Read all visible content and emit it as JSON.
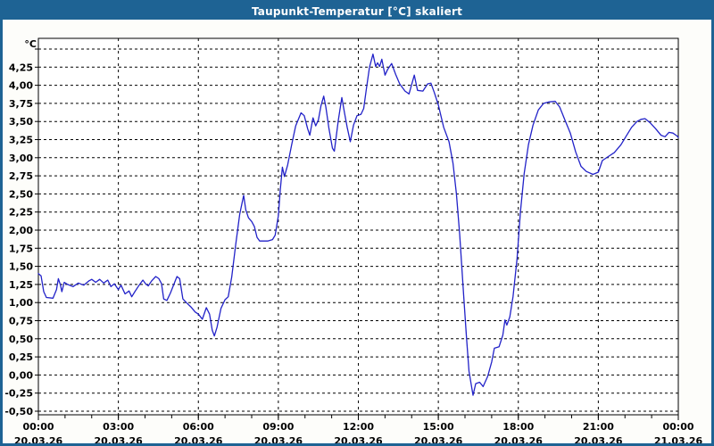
{
  "window": {
    "title": "Taupunkt-Temperatur [°C] skaliert",
    "titlebar_color": "#1e6394",
    "border_color": "#1e6394",
    "background_color": "#fdfdfa"
  },
  "chart_data": {
    "type": "line",
    "title": "Taupunkt-Temperatur [°C] skaliert",
    "y_unit_label": "°C",
    "xlabel": "",
    "ylabel": "°C",
    "ylim": [
      -0.5,
      4.5
    ],
    "xlim_hours": [
      0,
      24
    ],
    "grid": "dashed",
    "legend_position": "none",
    "line_color": "#2222c8",
    "grid_color": "#000000",
    "y_ticks": [
      {
        "v": 4.5,
        "label": ""
      },
      {
        "v": 4.25,
        "label": "4,25"
      },
      {
        "v": 4.0,
        "label": "4,00"
      },
      {
        "v": 3.75,
        "label": "3,75"
      },
      {
        "v": 3.5,
        "label": "3,50"
      },
      {
        "v": 3.25,
        "label": "3,25"
      },
      {
        "v": 3.0,
        "label": "3,00"
      },
      {
        "v": 2.75,
        "label": "2,75"
      },
      {
        "v": 2.5,
        "label": "2,50"
      },
      {
        "v": 2.25,
        "label": "2,25"
      },
      {
        "v": 2.0,
        "label": "2,00"
      },
      {
        "v": 1.75,
        "label": "1,75"
      },
      {
        "v": 1.5,
        "label": "1,50"
      },
      {
        "v": 1.25,
        "label": "1,25"
      },
      {
        "v": 1.0,
        "label": "1,00"
      },
      {
        "v": 0.75,
        "label": "0,75"
      },
      {
        "v": 0.5,
        "label": "0,50"
      },
      {
        "v": 0.25,
        "label": "0,25"
      },
      {
        "v": 0.0,
        "label": "0,00"
      },
      {
        "v": -0.25,
        "label": "-0,25"
      },
      {
        "v": -0.5,
        "label": "-0,50"
      }
    ],
    "x_major_ticks": [
      {
        "hour": 0,
        "time": "00:00",
        "date": "20.03.26"
      },
      {
        "hour": 3,
        "time": "03:00",
        "date": "20.03.26"
      },
      {
        "hour": 6,
        "time": "06:00",
        "date": "20.03.26"
      },
      {
        "hour": 9,
        "time": "09:00",
        "date": "20.03.26"
      },
      {
        "hour": 12,
        "time": "12:00",
        "date": "20.03.26"
      },
      {
        "hour": 15,
        "time": "15:00",
        "date": "20.03.26"
      },
      {
        "hour": 18,
        "time": "18:00",
        "date": "20.03.26"
      },
      {
        "hour": 21,
        "time": "21:00",
        "date": "20.03.26"
      },
      {
        "hour": 24,
        "time": "00:00",
        "date": "21.03.26"
      }
    ],
    "x_minor_step_hours": 1,
    "series": [
      {
        "name": "Taupunkt-Temperatur",
        "points": [
          [
            0.0,
            1.4
          ],
          [
            0.1,
            1.37
          ],
          [
            0.2,
            1.15
          ],
          [
            0.3,
            1.07
          ],
          [
            0.55,
            1.06
          ],
          [
            0.68,
            1.18
          ],
          [
            0.75,
            1.33
          ],
          [
            0.83,
            1.24
          ],
          [
            0.88,
            1.15
          ],
          [
            0.97,
            1.28
          ],
          [
            1.1,
            1.25
          ],
          [
            1.3,
            1.22
          ],
          [
            1.5,
            1.27
          ],
          [
            1.7,
            1.24
          ],
          [
            1.9,
            1.3
          ],
          [
            2.0,
            1.32
          ],
          [
            2.15,
            1.28
          ],
          [
            2.3,
            1.32
          ],
          [
            2.45,
            1.27
          ],
          [
            2.6,
            1.31
          ],
          [
            2.72,
            1.22
          ],
          [
            2.85,
            1.26
          ],
          [
            3.0,
            1.18
          ],
          [
            3.1,
            1.24
          ],
          [
            3.25,
            1.12
          ],
          [
            3.4,
            1.16
          ],
          [
            3.5,
            1.08
          ],
          [
            3.62,
            1.15
          ],
          [
            3.78,
            1.24
          ],
          [
            3.92,
            1.31
          ],
          [
            4.02,
            1.26
          ],
          [
            4.12,
            1.23
          ],
          [
            4.25,
            1.3
          ],
          [
            4.4,
            1.36
          ],
          [
            4.52,
            1.33
          ],
          [
            4.62,
            1.26
          ],
          [
            4.7,
            1.05
          ],
          [
            4.82,
            1.03
          ],
          [
            4.95,
            1.13
          ],
          [
            5.1,
            1.27
          ],
          [
            5.2,
            1.36
          ],
          [
            5.3,
            1.33
          ],
          [
            5.42,
            1.05
          ],
          [
            5.55,
            1.0
          ],
          [
            5.72,
            0.94
          ],
          [
            5.88,
            0.87
          ],
          [
            6.0,
            0.84
          ],
          [
            6.15,
            0.77
          ],
          [
            6.3,
            0.93
          ],
          [
            6.42,
            0.84
          ],
          [
            6.52,
            0.62
          ],
          [
            6.6,
            0.54
          ],
          [
            6.7,
            0.66
          ],
          [
            6.85,
            0.92
          ],
          [
            7.0,
            1.04
          ],
          [
            7.12,
            1.08
          ],
          [
            7.25,
            1.35
          ],
          [
            7.4,
            1.8
          ],
          [
            7.55,
            2.22
          ],
          [
            7.7,
            2.48
          ],
          [
            7.78,
            2.28
          ],
          [
            7.88,
            2.17
          ],
          [
            8.0,
            2.12
          ],
          [
            8.1,
            2.05
          ],
          [
            8.2,
            1.9
          ],
          [
            8.3,
            1.85
          ],
          [
            8.6,
            1.85
          ],
          [
            8.78,
            1.87
          ],
          [
            8.88,
            1.93
          ],
          [
            9.0,
            2.2
          ],
          [
            9.07,
            2.55
          ],
          [
            9.15,
            2.87
          ],
          [
            9.23,
            2.74
          ],
          [
            9.35,
            2.9
          ],
          [
            9.5,
            3.18
          ],
          [
            9.65,
            3.44
          ],
          [
            9.85,
            3.62
          ],
          [
            9.97,
            3.58
          ],
          [
            10.1,
            3.4
          ],
          [
            10.18,
            3.31
          ],
          [
            10.3,
            3.55
          ],
          [
            10.4,
            3.44
          ],
          [
            10.5,
            3.52
          ],
          [
            10.6,
            3.72
          ],
          [
            10.7,
            3.85
          ],
          [
            10.78,
            3.7
          ],
          [
            10.9,
            3.4
          ],
          [
            11.03,
            3.13
          ],
          [
            11.1,
            3.09
          ],
          [
            11.25,
            3.52
          ],
          [
            11.38,
            3.83
          ],
          [
            11.48,
            3.62
          ],
          [
            11.58,
            3.42
          ],
          [
            11.7,
            3.22
          ],
          [
            11.82,
            3.45
          ],
          [
            11.95,
            3.58
          ],
          [
            12.1,
            3.6
          ],
          [
            12.2,
            3.68
          ],
          [
            12.3,
            3.95
          ],
          [
            12.42,
            4.25
          ],
          [
            12.55,
            4.43
          ],
          [
            12.65,
            4.26
          ],
          [
            12.72,
            4.31
          ],
          [
            12.8,
            4.26
          ],
          [
            12.88,
            4.36
          ],
          [
            13.0,
            4.14
          ],
          [
            13.1,
            4.22
          ],
          [
            13.25,
            4.3
          ],
          [
            13.4,
            4.15
          ],
          [
            13.55,
            4.02
          ],
          [
            13.75,
            3.92
          ],
          [
            13.9,
            3.88
          ],
          [
            14.1,
            4.14
          ],
          [
            14.22,
            3.93
          ],
          [
            14.42,
            3.92
          ],
          [
            14.6,
            4.02
          ],
          [
            14.72,
            4.03
          ],
          [
            14.85,
            3.9
          ],
          [
            15.0,
            3.73
          ],
          [
            15.2,
            3.42
          ],
          [
            15.4,
            3.22
          ],
          [
            15.55,
            2.92
          ],
          [
            15.68,
            2.5
          ],
          [
            15.8,
            1.95
          ],
          [
            15.95,
            1.1
          ],
          [
            16.05,
            0.55
          ],
          [
            16.15,
            0.05
          ],
          [
            16.3,
            -0.28
          ],
          [
            16.4,
            -0.12
          ],
          [
            16.55,
            -0.1
          ],
          [
            16.68,
            -0.16
          ],
          [
            16.85,
            -0.02
          ],
          [
            17.0,
            0.18
          ],
          [
            17.1,
            0.37
          ],
          [
            17.28,
            0.39
          ],
          [
            17.42,
            0.55
          ],
          [
            17.5,
            0.76
          ],
          [
            17.57,
            0.69
          ],
          [
            17.68,
            0.8
          ],
          [
            17.8,
            1.08
          ],
          [
            17.95,
            1.6
          ],
          [
            18.08,
            2.25
          ],
          [
            18.22,
            2.78
          ],
          [
            18.38,
            3.18
          ],
          [
            18.55,
            3.45
          ],
          [
            18.75,
            3.66
          ],
          [
            18.95,
            3.75
          ],
          [
            19.15,
            3.77
          ],
          [
            19.38,
            3.78
          ],
          [
            19.55,
            3.7
          ],
          [
            19.75,
            3.52
          ],
          [
            19.95,
            3.34
          ],
          [
            20.15,
            3.08
          ],
          [
            20.35,
            2.88
          ],
          [
            20.55,
            2.81
          ],
          [
            20.8,
            2.77
          ],
          [
            21.0,
            2.8
          ],
          [
            21.15,
            2.96
          ],
          [
            21.35,
            3.01
          ],
          [
            21.6,
            3.07
          ],
          [
            21.85,
            3.18
          ],
          [
            22.05,
            3.3
          ],
          [
            22.25,
            3.42
          ],
          [
            22.45,
            3.5
          ],
          [
            22.6,
            3.53
          ],
          [
            22.75,
            3.54
          ],
          [
            22.95,
            3.48
          ],
          [
            23.15,
            3.4
          ],
          [
            23.35,
            3.31
          ],
          [
            23.5,
            3.29
          ],
          [
            23.65,
            3.35
          ],
          [
            23.8,
            3.34
          ],
          [
            23.95,
            3.3
          ],
          [
            24.0,
            3.28
          ]
        ]
      }
    ]
  }
}
